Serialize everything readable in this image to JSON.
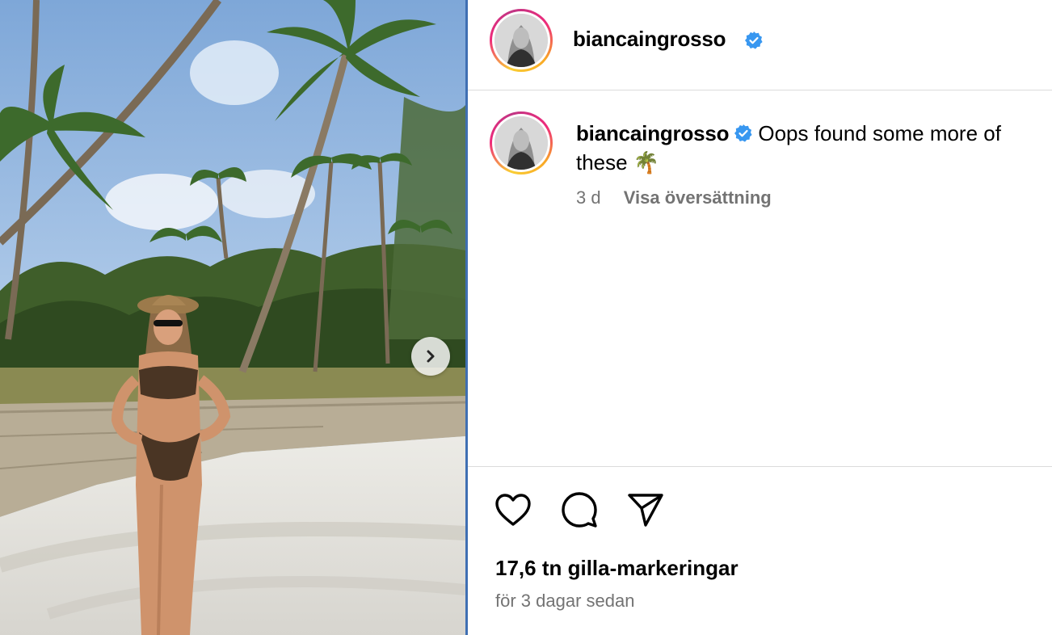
{
  "photo": {
    "alt_icon": "beach-photo",
    "next_icon": "chevron-right-icon"
  },
  "header": {
    "username": "biancaingrosso",
    "verified_icon": "verified-badge-icon"
  },
  "caption": {
    "username": "biancaingrosso",
    "text": "Oops found some more of these 🌴",
    "time": "3 d",
    "translate_label": "Visa översättning"
  },
  "actions": {
    "like_icon": "heart-icon",
    "comment_icon": "comment-icon",
    "share_icon": "paper-plane-icon"
  },
  "stats": {
    "likes": "17,6 tn gilla-markeringar",
    "posted": "för 3 dagar sedan"
  },
  "colors": {
    "verified": "#3897f0",
    "secondary_text": "#737373",
    "divider": "#3f6fb3"
  }
}
